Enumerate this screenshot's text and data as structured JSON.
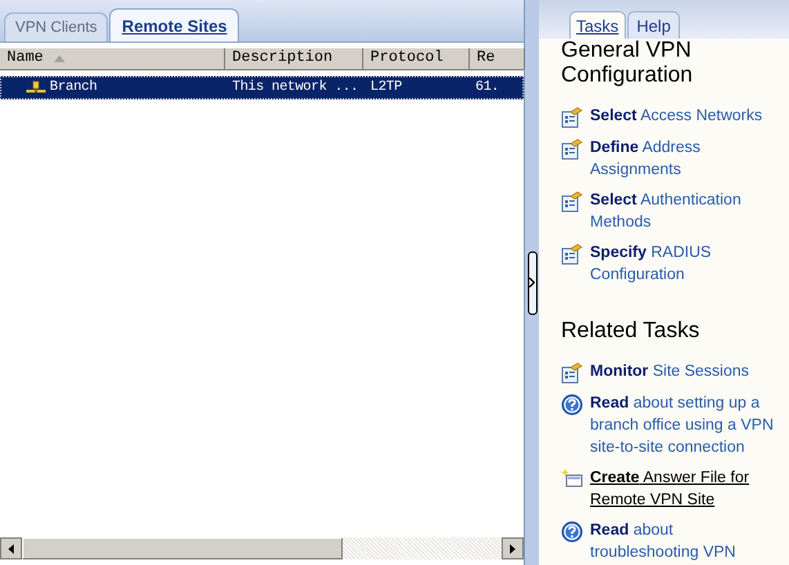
{
  "left_tabs": [
    {
      "label": "VPN Clients",
      "selected": false
    },
    {
      "label": "Remote Sites",
      "selected": true
    }
  ],
  "table": {
    "columns": [
      {
        "label": "Name",
        "sorted": true
      },
      {
        "label": "Description",
        "sorted": false
      },
      {
        "label": "Protocol",
        "sorted": false
      },
      {
        "label": "Re",
        "sorted": false
      }
    ],
    "rows": [
      {
        "cells": [
          "Branch",
          "This network ...",
          "L2TP",
          "61."
        ],
        "selected": true
      }
    ]
  },
  "right_tabs": [
    {
      "label": "Tasks",
      "selected": true
    },
    {
      "label": "Help",
      "selected": false
    }
  ],
  "sections": [
    {
      "title": "General VPN Configuration",
      "items": [
        {
          "kind": "task",
          "verb": "Select",
          "rest": "Access Networks",
          "hovered": false
        },
        {
          "kind": "task",
          "verb": "Define",
          "rest": "Address Assignments",
          "hovered": false
        },
        {
          "kind": "task",
          "verb": "Select",
          "rest": "Authentication Methods",
          "hovered": false
        },
        {
          "kind": "task",
          "verb": "Specify",
          "rest": "RADIUS Configuration",
          "hovered": false
        }
      ]
    },
    {
      "title": "Related Tasks",
      "items": [
        {
          "kind": "task",
          "verb": "Monitor",
          "rest": "Site Sessions",
          "hovered": false
        },
        {
          "kind": "help",
          "verb": "Read",
          "rest": "about setting up a branch office using a VPN site-to-site connection",
          "hovered": false
        },
        {
          "kind": "create",
          "verb": "Create",
          "rest": "Answer File for Remote VPN Site",
          "hovered": true
        },
        {
          "kind": "help",
          "verb": "Read",
          "rest": "about troubleshooting VPN",
          "hovered": false
        }
      ]
    }
  ]
}
